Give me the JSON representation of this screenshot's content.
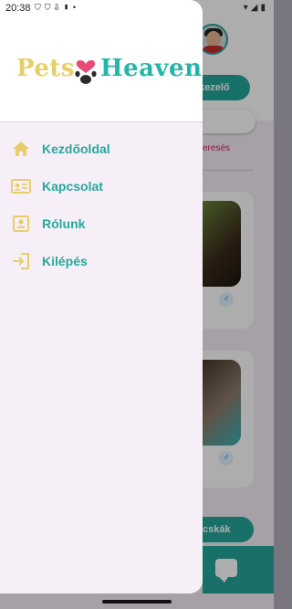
{
  "status_bar": {
    "time": "20:38",
    "left_icons": [
      "shield-icon",
      "shield-icon",
      "download-icon",
      "sd-card-icon",
      "dot-icon"
    ],
    "right_icons": [
      "wifi-icon",
      "signal-icon",
      "battery-icon"
    ]
  },
  "background": {
    "manager_button_label": "kezelő",
    "search_link": "eresés",
    "bottom_button_label": "cskák"
  },
  "drawer": {
    "logo": {
      "part1": "Pets",
      "part2": "Heaven"
    },
    "items": [
      {
        "label": "Kezdőoldal",
        "icon": "home-icon"
      },
      {
        "label": "Kapcsolat",
        "icon": "contact-card-icon"
      },
      {
        "label": "Rólunk",
        "icon": "account-box-icon"
      },
      {
        "label": "Kilépés",
        "icon": "logout-icon"
      }
    ]
  },
  "colors": {
    "accent": "#27a89b",
    "logo_yellow": "#e6cf6a",
    "logo_pink": "#e84a7a",
    "drawer_bg": "#f6eff8"
  }
}
